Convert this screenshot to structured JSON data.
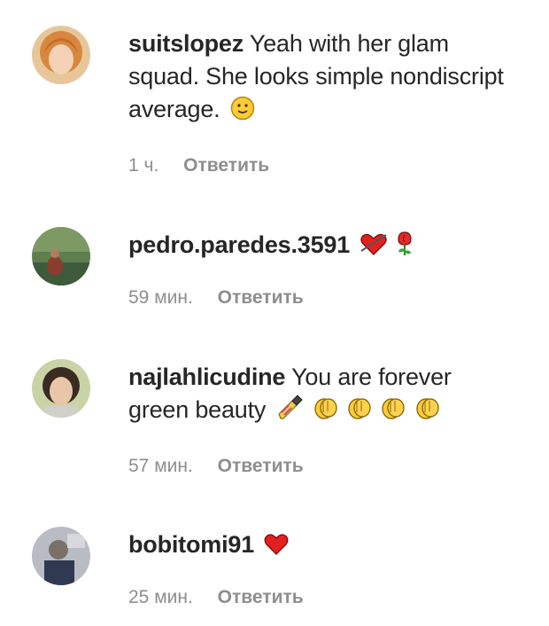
{
  "comments": [
    {
      "username": "suitslopez",
      "text": "Yeah with her glam squad. She looks simple nondiscript average.",
      "emojis": [
        "slightly-smiling-face"
      ],
      "time": "1 ч.",
      "reply_label": "Ответить"
    },
    {
      "username": "pedro.paredes.3591",
      "text": "",
      "emojis": [
        "heart-with-arrow",
        "rose"
      ],
      "time": "59 мин.",
      "reply_label": "Ответить"
    },
    {
      "username": "najlahlicudine",
      "text": "You are forever green beauty",
      "emojis": [
        "nail-polish",
        "clapping-hands",
        "clapping-hands",
        "clapping-hands",
        "clapping-hands"
      ],
      "time": "57 мин.",
      "reply_label": "Ответить"
    },
    {
      "username": "bobitomi91",
      "text": "",
      "emojis": [
        "red-heart"
      ],
      "time": "25 мин.",
      "reply_label": "Ответить"
    }
  ]
}
